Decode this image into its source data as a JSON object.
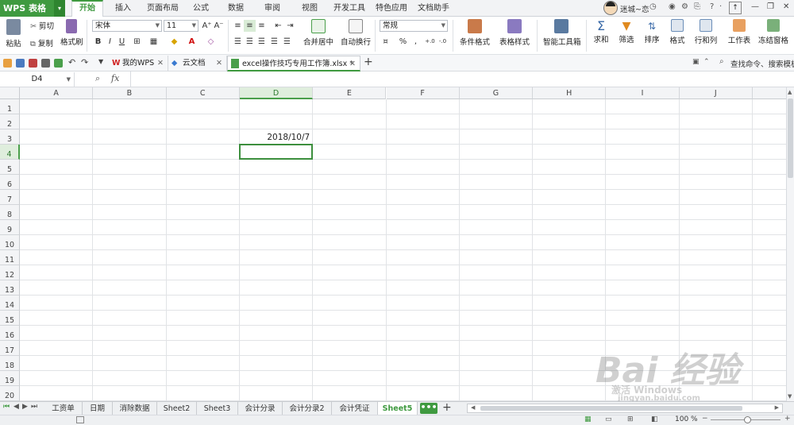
{
  "app": {
    "name": "WPS 表格"
  },
  "menu_tabs": [
    {
      "label": "开始",
      "active": true
    },
    {
      "label": "插入"
    },
    {
      "label": "页面布局"
    },
    {
      "label": "公式"
    },
    {
      "label": "数据"
    },
    {
      "label": "审阅"
    },
    {
      "label": "视图"
    },
    {
      "label": "开发工具"
    },
    {
      "label": "特色应用"
    },
    {
      "label": "文档助手"
    }
  ],
  "user": {
    "name": "迷城~恋"
  },
  "ribbon": {
    "paste": "粘贴",
    "cut": "剪切",
    "copy": "复制",
    "format_painter": "格式刷",
    "font_name": "宋体",
    "font_size": "11",
    "merge_center": "合并居中",
    "wrap_text": "自动换行",
    "number_format": "常规",
    "conditional_format": "条件格式",
    "table_style": "表格样式",
    "smart_toolbox": "智能工具箱",
    "sum": "求和",
    "filter": "筛选",
    "sort": "排序",
    "format": "格式",
    "row_col": "行和列",
    "worksheet": "工作表",
    "freeze": "冻结窗格",
    "bold": "B",
    "italic": "I",
    "underline": "U",
    "grow_font": "A⁺",
    "shrink_font": "A⁻"
  },
  "doc_tabs": [
    {
      "label": "我的WPS"
    },
    {
      "label": "云文档"
    },
    {
      "label": "excel操作技巧专用工作簿.xlsx *",
      "active": true
    }
  ],
  "search_placeholder": "查找命令、搜索模板",
  "formula_bar": {
    "name_box": "D4",
    "fx": "fx",
    "value": ""
  },
  "columns": [
    "A",
    "B",
    "C",
    "D",
    "E",
    "F",
    "G",
    "H",
    "I",
    "J"
  ],
  "rows": [
    "1",
    "2",
    "3",
    "4",
    "5",
    "6",
    "7",
    "8",
    "9",
    "10",
    "11",
    "12",
    "13",
    "14",
    "15",
    "16",
    "17",
    "18",
    "19",
    "20"
  ],
  "cells": {
    "D3": "2018/10/7"
  },
  "active_cell": "D4",
  "sheets": [
    {
      "label": "工资单"
    },
    {
      "label": "日期"
    },
    {
      "label": "消除数据"
    },
    {
      "label": "Sheet2"
    },
    {
      "label": "Sheet3"
    },
    {
      "label": "会计分录"
    },
    {
      "label": "会计分录2"
    },
    {
      "label": "会计凭证"
    },
    {
      "label": "Sheet5",
      "active": true
    }
  ],
  "status": {
    "zoom": "100 %"
  },
  "watermark": {
    "brand": "Bai 经验",
    "url": "jingyan.baidu.com",
    "activate": "激活 Windows"
  }
}
